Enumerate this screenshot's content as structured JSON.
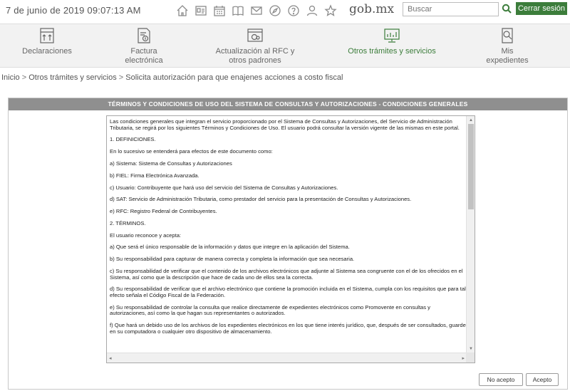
{
  "header": {
    "datetime": "7 de junio de 2019 09:07:13 AM",
    "brand": "gob.mx",
    "search_placeholder": "Buscar",
    "logout_label": "Cerrar sesión",
    "icons": [
      "home-icon",
      "id-card-icon",
      "calendar-icon",
      "book-icon",
      "mail-icon",
      "compass-icon",
      "help-icon",
      "user-icon",
      "star-icon"
    ]
  },
  "nav": {
    "items": [
      {
        "label1": "Declaraciones",
        "label2": "",
        "icon": "declaraciones-icon"
      },
      {
        "label1": "Factura",
        "label2": "electrónica",
        "icon": "factura-icon"
      },
      {
        "label1": "Actualización al RFC y",
        "label2": "otros padrones",
        "icon": "rfc-icon"
      },
      {
        "label1": "Otros trámites y servicios",
        "label2": "",
        "icon": "tramites-icon"
      },
      {
        "label1": "Mis",
        "label2": "expedientes",
        "icon": "expedientes-icon"
      }
    ],
    "active_color": "#3c7d3b"
  },
  "breadcrumb": {
    "items": [
      "Inicio",
      "Otros trámites y servicios",
      "Solicita autorización para que enajenes acciones a costo fiscal"
    ],
    "separator": ">"
  },
  "panel": {
    "title": "TÉRMINOS Y CONDICIONES DE USO DEL SISTEMA DE CONSULTAS Y AUTORIZACIONES - CONDICIONES GENERALES",
    "terms": [
      "Las condiciones generales que integran el servicio proporcionado por el Sistema de Consultas y Autorizaciones, del Servicio de Administración Tributaria, se regirá por los siguientes Términos y Condiciones de Uso. El usuario podrá consultar la versión vigente de las mismas en este portal.",
      "1. DEFINICIONES.",
      "En lo sucesivo se entenderá para efectos de este documento como:",
      "a) Sistema: Sistema de Consultas y Autorizaciones",
      "b) FIEL: Firma Electrónica Avanzada.",
      "c) Usuario: Contribuyente que hará uso del servicio del Sistema de Consultas y Autorizaciones.",
      "d) SAT: Servicio de Administración Tributaria, como prestador del servicio para la presentación de Consultas y Autorizaciones.",
      "e) RFC: Registro Federal de Contribuyentes.",
      "2. TÉRMINOS.",
      "El usuario reconoce y acepta:",
      "a) Que será el único responsable de la información y datos que integre en la aplicación del Sistema.",
      "b) Su responsabilidad para capturar de manera correcta y completa la información que sea necesaria.",
      "c) Su responsabilidad de verificar que el contenido de los archivos electrónicos que adjunte al Sistema sea congruente con el de los ofrecidos en el Sistema, así como que la descripción que hace de cada uno de ellos sea la correcta.",
      "d) Su responsabilidad de verificar que el archivo electrónico que contiene la promoción incluida en el Sistema, cumpla con los requisitos que para tal efecto señala el Código Fiscal de la Federación.",
      "e) Su responsabilidad de controlar la consulta que realice directamente de expedientes electrónicos como Promovente en consultas y autorizaciones, así como la que hagan sus representantes o autorizados.",
      "f) Que hará un debido uso de los archivos de los expedientes electrónicos en los que tiene interés jurídico, que, después de ser consultados, guarde en su computadora o cualquier otro dispositivo de almacenamiento."
    ],
    "reject_label": "No acepto",
    "accept_label": "Acepto"
  }
}
